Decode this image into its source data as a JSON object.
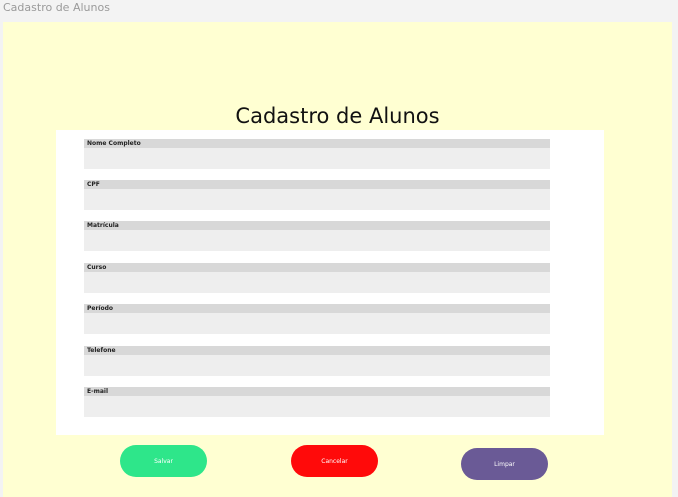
{
  "window": {
    "title": "Cadastro de Alunos"
  },
  "page": {
    "title": "Cadastro de Alunos"
  },
  "form": {
    "fields": [
      {
        "label": "Nome Completo",
        "value": ""
      },
      {
        "label": "CPF",
        "value": ""
      },
      {
        "label": "Matrícula",
        "value": ""
      },
      {
        "label": "Curso",
        "value": ""
      },
      {
        "label": "Período",
        "value": ""
      },
      {
        "label": "Telefone",
        "value": ""
      },
      {
        "label": "E-mail",
        "value": ""
      }
    ]
  },
  "actions": {
    "save_label": "Salvar",
    "cancel_label": "Cancelar",
    "clear_label": "Limpar"
  },
  "colors": {
    "background": "#ffffd2",
    "save": "#2ee68a",
    "cancel": "#ff0a0a",
    "clear": "#6a5a96"
  }
}
